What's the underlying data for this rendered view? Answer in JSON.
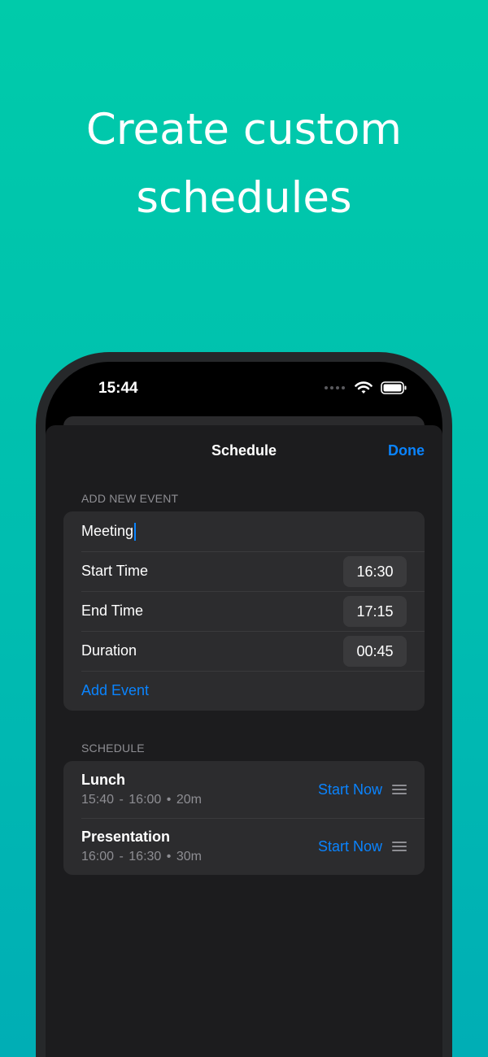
{
  "headline": {
    "line1": "Create custom",
    "line2": "schedules"
  },
  "status_bar": {
    "time": "15:44",
    "icons": [
      "signal-dots-icon",
      "wifi-icon",
      "battery-icon"
    ]
  },
  "nav": {
    "title": "Schedule",
    "done_label": "Done"
  },
  "add_event": {
    "header": "ADD NEW EVENT",
    "name_value": "Meeting",
    "start_label": "Start Time",
    "start_value": "16:30",
    "end_label": "End Time",
    "end_value": "17:15",
    "duration_label": "Duration",
    "duration_value": "00:45",
    "add_label": "Add Event"
  },
  "schedule": {
    "header": "SCHEDULE",
    "items": [
      {
        "title": "Lunch",
        "start": "15:40",
        "end": "16:00",
        "duration": "20m",
        "action": "Start Now"
      },
      {
        "title": "Presentation",
        "start": "16:00",
        "end": "16:30",
        "duration": "30m",
        "action": "Start Now"
      }
    ]
  },
  "colors": {
    "accent": "#0A84FF",
    "background_top": "#00CBAA",
    "background_bottom": "#00AEB5",
    "sheet": "#1C1C1E",
    "cell": "#2C2C2E"
  }
}
